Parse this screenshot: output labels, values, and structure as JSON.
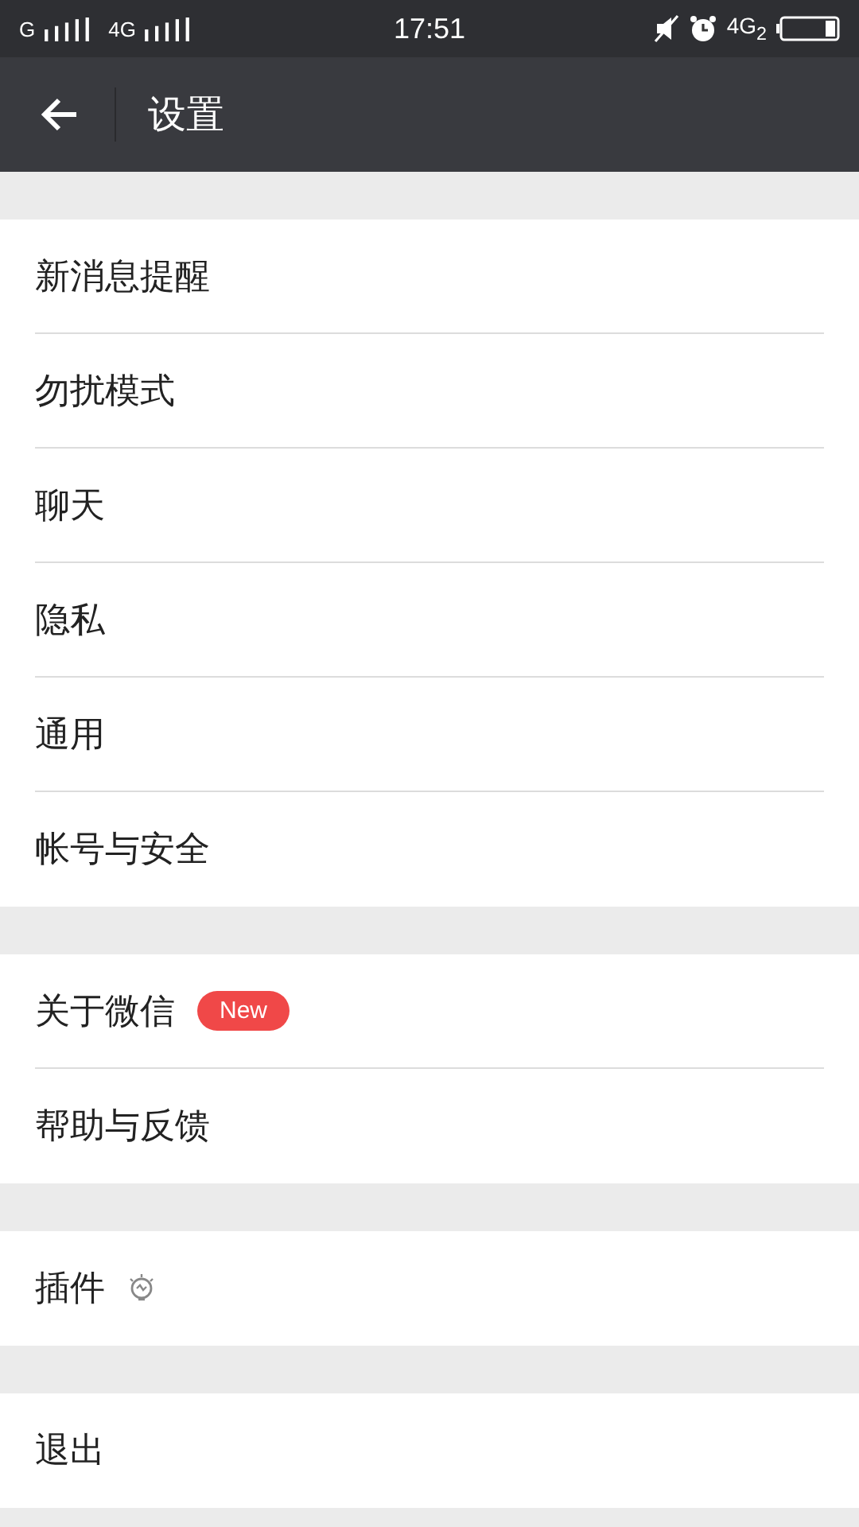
{
  "status_bar": {
    "carrier_1": "G",
    "carrier_2": "4G",
    "time": "17:51",
    "network": "4G$_{2}$"
  },
  "header": {
    "title": "设置"
  },
  "groups": [
    {
      "items": [
        {
          "label": "新消息提醒",
          "kind": "plain"
        },
        {
          "label": "勿扰模式",
          "kind": "plain"
        },
        {
          "label": "聊天",
          "kind": "plain"
        },
        {
          "label": "隐私",
          "kind": "plain"
        },
        {
          "label": "通用",
          "kind": "plain"
        },
        {
          "label": "帐号与安全",
          "kind": "plain"
        }
      ]
    },
    {
      "items": [
        {
          "label": "关于微信",
          "kind": "badge",
          "badge": "New"
        },
        {
          "label": "帮助与反馈",
          "kind": "plain"
        }
      ]
    },
    {
      "items": [
        {
          "label": "插件",
          "kind": "bulb"
        }
      ]
    },
    {
      "items": [
        {
          "label": "退出",
          "kind": "plain"
        }
      ]
    }
  ]
}
